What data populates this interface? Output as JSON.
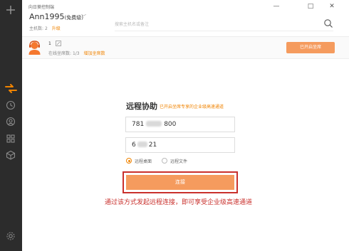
{
  "window": {
    "title": "向日葵控制端",
    "controls": [
      "—",
      "□",
      "✕"
    ]
  },
  "account": {
    "name": "Ann1995",
    "tier": "(免费级)",
    "hosts_label": "主机数:",
    "hosts_value": "2",
    "upgrade_label": "升级"
  },
  "search": {
    "placeholder": "搜索主机名或备注"
  },
  "seat": {
    "count": "1",
    "info_label": "在线坐席数:",
    "info_value": "1/3",
    "add_seat_label": "增加坐席数",
    "button_label": "已开启坐席"
  },
  "remote": {
    "title": "远程协助",
    "subtitle": "已开启坐席专享的企业级高速通道",
    "id_prefix": "781",
    "id_suffix": "800",
    "code_prefix": "6",
    "code_suffix": "21",
    "options": [
      "远程桌面",
      "远程文件"
    ],
    "connect_label": "连接"
  },
  "annotation": "通过该方式发起远程连接，即可享受企业级高速通道",
  "colors": {
    "accent": "#f08300",
    "button": "#f59b5e",
    "sidebar": "#2c2c2c",
    "annotation": "#c9302c"
  },
  "icons": {
    "sidebar": [
      "plus-icon",
      "remote-control-icon",
      "clock-icon",
      "headset-icon",
      "apps-icon",
      "cube-icon",
      "settings-icon"
    ],
    "search": "search-icon"
  }
}
